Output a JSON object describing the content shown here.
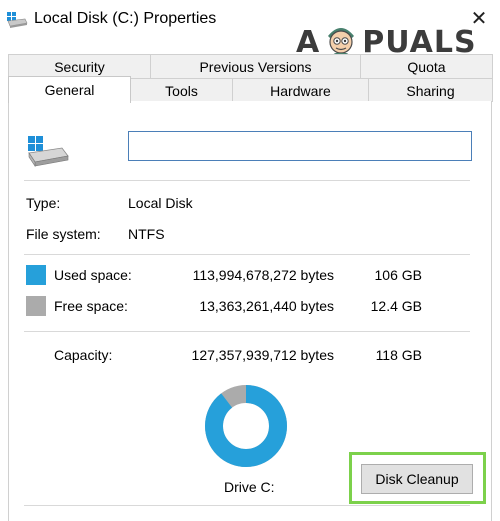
{
  "window": {
    "title": "Local Disk (C:) Properties",
    "close_glyph": "✕"
  },
  "watermark": {
    "left_text": "A",
    "right_text": "PUALS"
  },
  "tabs": {
    "row1": [
      "Security",
      "Previous Versions",
      "Quota"
    ],
    "row2": [
      "General",
      "Tools",
      "Hardware",
      "Sharing"
    ],
    "active": "General"
  },
  "general": {
    "name_value": "",
    "type_label": "Type:",
    "type_value": "Local Disk",
    "fs_label": "File system:",
    "fs_value": "NTFS",
    "used": {
      "label": "Used space:",
      "bytes": "113,994,678,272 bytes",
      "size": "106 GB",
      "color": "#26a0da"
    },
    "free": {
      "label": "Free space:",
      "bytes": "13,363,261,440 bytes",
      "size": "12.4 GB",
      "color": "#ababab"
    },
    "capacity": {
      "label": "Capacity:",
      "bytes": "127,357,939,712 bytes",
      "size": "118 GB"
    },
    "used_fraction": 0.8951,
    "drive_label": "Drive C:",
    "cleanup_label": "Disk Cleanup",
    "highlight_color": "#7cd14b"
  },
  "icons": {
    "title": "drive-icon",
    "close": "close-icon",
    "drive": "windows-drive-icon"
  }
}
